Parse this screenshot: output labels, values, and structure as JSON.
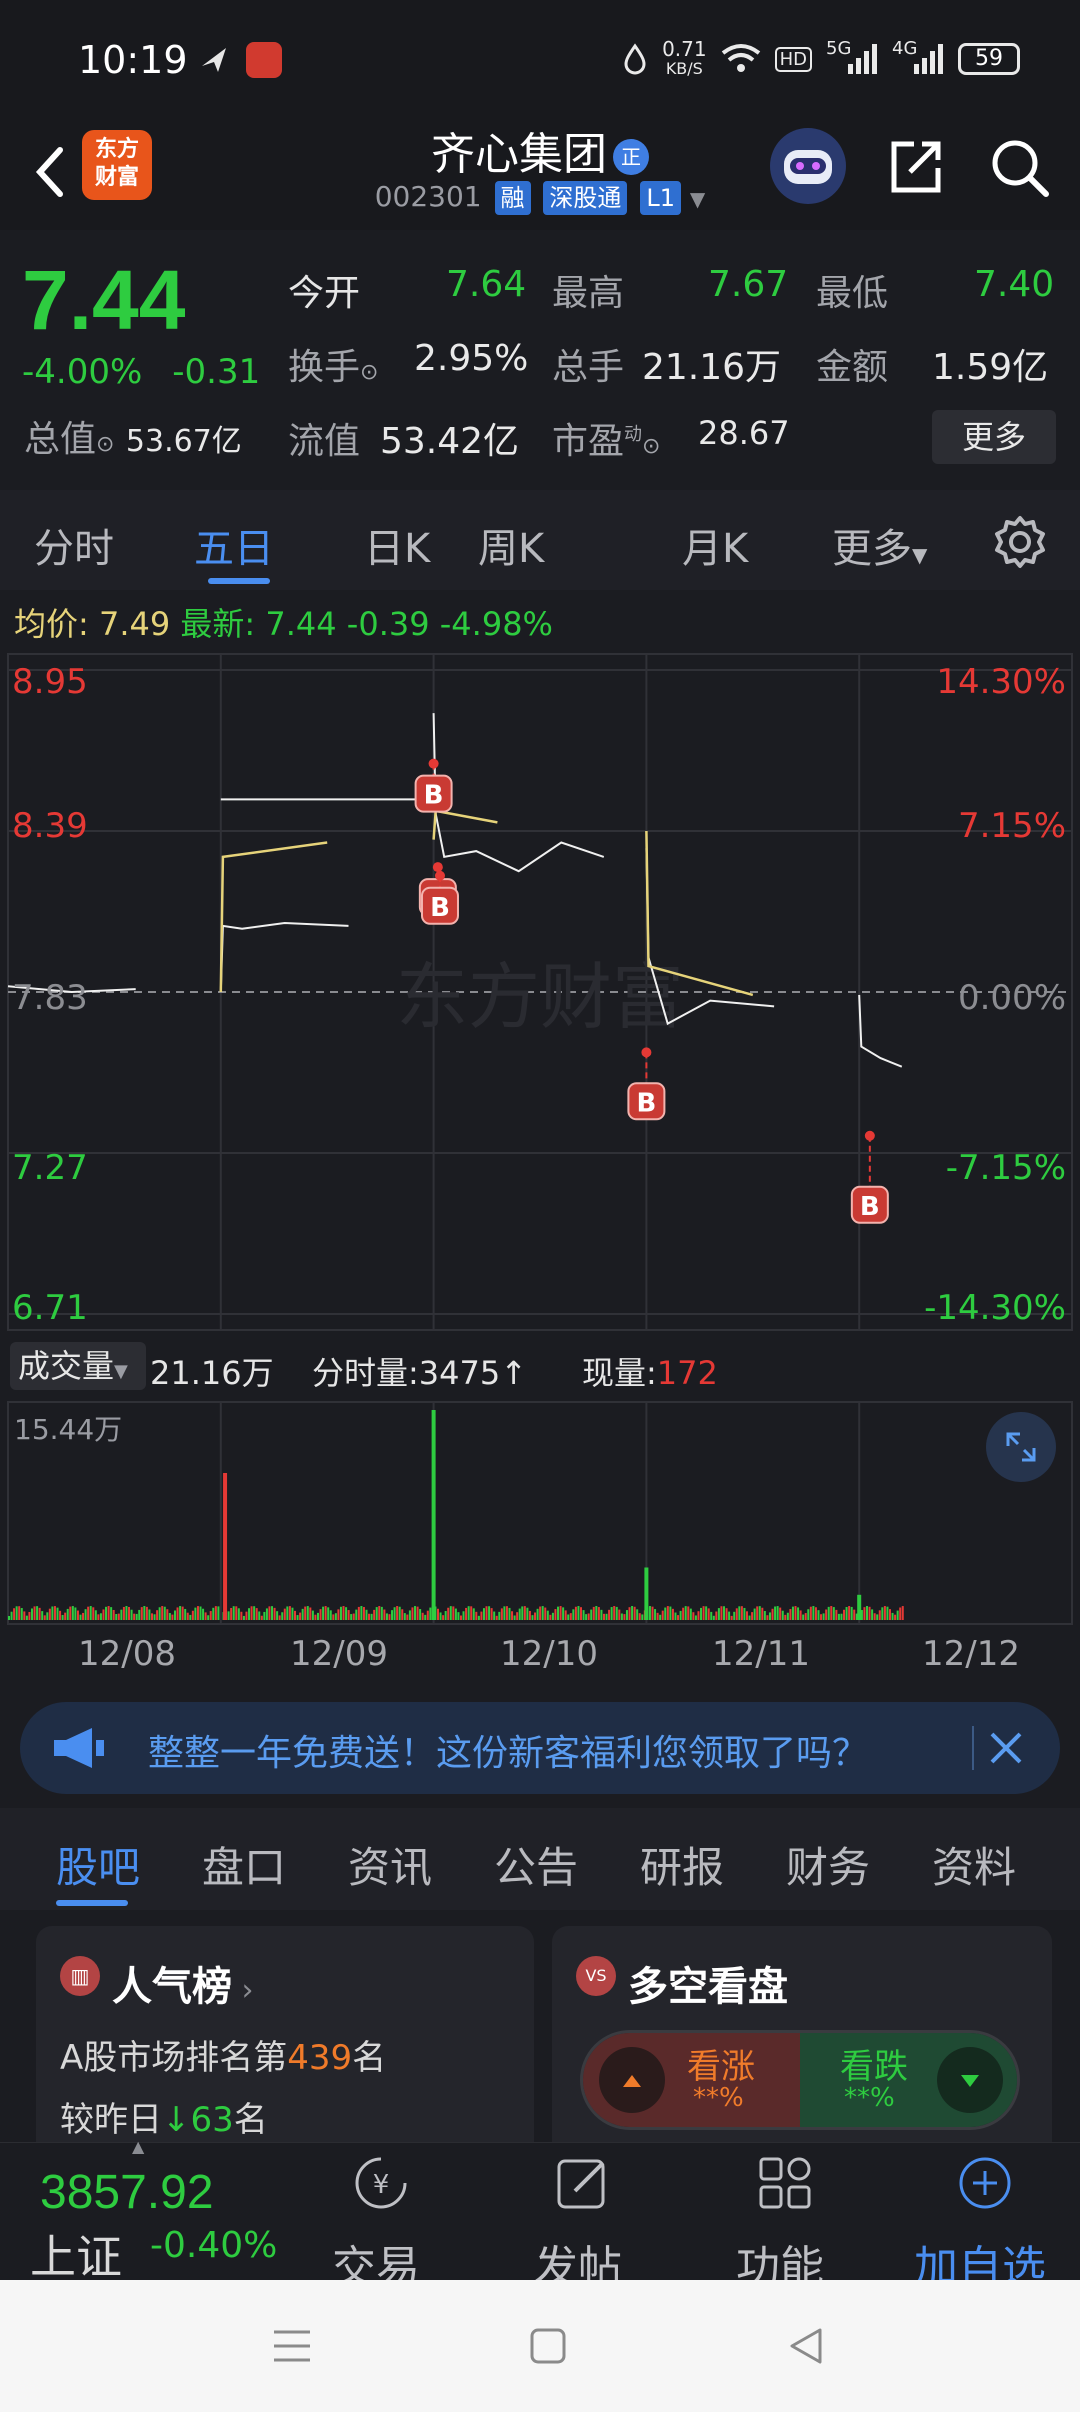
{
  "status_bar": {
    "time": "10:19",
    "net_speed_value": "0.71",
    "net_speed_unit": "KB/S",
    "hd": "HD",
    "signal_1": "5G",
    "signal_2": "4G",
    "battery": "59"
  },
  "header": {
    "logo_line1": "东方",
    "logo_line2": "财富",
    "stock_name": "齐心集团",
    "badge": "正",
    "stock_code": "002301",
    "tag_rong": "融",
    "tag_sgt": "深股通",
    "tag_l1": "L1"
  },
  "quote": {
    "price": "7.44",
    "change_pct": "-4.00%",
    "change_abs": "-0.31",
    "open_label": "今开",
    "open_value": "7.64",
    "high_label": "最高",
    "high_value": "7.67",
    "low_label": "最低",
    "low_value": "7.40",
    "turnover_label": "换手",
    "turnover_value": "2.95%",
    "volume_label": "总手",
    "volume_value": "21.16万",
    "amount_label": "金额",
    "amount_value": "1.59亿",
    "mktcap_label": "总值",
    "mktcap_value": "53.67亿",
    "float_label": "流值",
    "float_value": "53.42亿",
    "pe_label": "市盈",
    "pe_sup": "动",
    "pe_value": "28.67",
    "more_label": "更多"
  },
  "tabs": {
    "items": [
      "分时",
      "五日",
      "日K",
      "周K",
      "月K",
      "更多"
    ],
    "active": "五日"
  },
  "infoline": {
    "avg_label": "均价:",
    "avg_value": "7.49",
    "latest_label": "最新:",
    "latest_value": "7.44",
    "latest_chg": "-0.39",
    "latest_pct": "-4.98%"
  },
  "chart_data": {
    "type": "line",
    "left_axis": [
      "8.95",
      "8.39",
      "7.83",
      "7.27",
      "6.71"
    ],
    "right_axis": [
      "14.30%",
      "7.15%",
      "0.00%",
      "-7.15%",
      "-14.30%"
    ],
    "ylim": [
      6.71,
      8.95
    ],
    "days": [
      "12/08",
      "12/09",
      "12/10",
      "12/11",
      "12/12"
    ],
    "series": [
      {
        "x": [
          0,
          0.3,
          0.6,
          1.0,
          1.01,
          1.1,
          1.3,
          1.6,
          2.0,
          2.01,
          2.05,
          2.2,
          2.4,
          2.6,
          2.8,
          3.0,
          3.01,
          3.1,
          3.3,
          3.6,
          4.0,
          4.01,
          4.1,
          4.2
        ],
        "y": [
          7.85,
          7.83,
          7.84,
          7.83,
          8.06,
          8.05,
          8.07,
          8.06,
          8.8,
          8.45,
          8.3,
          8.32,
          8.25,
          8.35,
          8.3,
          8.33,
          7.95,
          7.72,
          7.8,
          7.78,
          7.82,
          7.64,
          7.6,
          7.57
        ]
      },
      {
        "x": [
          0,
          1.0,
          1.01,
          1.5,
          2.0,
          2.01,
          2.3,
          3.0,
          3.01,
          3.5,
          4.0
        ],
        "y": [
          7.84,
          7.83,
          8.3,
          8.35,
          8.36,
          8.46,
          8.42,
          8.39,
          7.92,
          7.82,
          7.81
        ]
      },
      {
        "x": [
          1.0,
          1.01,
          2.0
        ],
        "y": [
          8.5,
          8.5,
          8.5
        ]
      }
    ],
    "b_markers": [
      {
        "x": 2.0,
        "y": 8.52
      },
      {
        "x": 2.02,
        "y": 8.16
      },
      {
        "x": 2.03,
        "y": 8.13
      },
      {
        "x": 3.0,
        "y": 7.45
      },
      {
        "x": 4.05,
        "y": 7.09
      }
    ],
    "watermark": "东方财富"
  },
  "volume": {
    "selector_label": "成交量",
    "total": "21.16万",
    "fs_label": "分时量:",
    "fs_value": "3475",
    "cur_label": "现量:",
    "cur_value": "172",
    "max_label": "15.44万"
  },
  "volume_data": {
    "spikes": [
      {
        "x": 1.02,
        "h": 0.7,
        "color": "#e53935"
      },
      {
        "x": 2.0,
        "h": 1.0,
        "color": "#2ecc40"
      },
      {
        "x": 3.0,
        "h": 0.25,
        "color": "#2ecc40"
      },
      {
        "x": 4.0,
        "h": 0.12,
        "color": "#2ecc40"
      }
    ]
  },
  "banner": {
    "text": "整整一年免费送！这份新客福利您领取了吗？"
  },
  "lower_tabs": {
    "items": [
      "股吧",
      "盘口",
      "资讯",
      "公告",
      "研报",
      "财务",
      "资料"
    ],
    "active": "股吧"
  },
  "cards": {
    "popularity_title": "人气榜",
    "rank_prefix": "A股市场排名第",
    "rank_value": "439",
    "rank_suffix": "名",
    "change_prefix": "较昨日",
    "change_value": "63",
    "change_suffix": "名",
    "vs_title": "多空看盘",
    "vs_icon": "VS",
    "bull_label": "看涨",
    "bull_value": "**%",
    "bear_label": "看跌",
    "bear_value": "**%"
  },
  "bottom_nav": {
    "index_value": "3857.92",
    "index_name": "上证",
    "index_change": "-0.40%",
    "trade": "交易",
    "post": "发帖",
    "functions": "功能",
    "add_watch": "加自选",
    "trade_icon_text": "¥"
  },
  "colors": {
    "up": "#e53935",
    "down": "#2ecc40",
    "accent": "#4a8ef0",
    "avg_line": "#e6d37a"
  }
}
